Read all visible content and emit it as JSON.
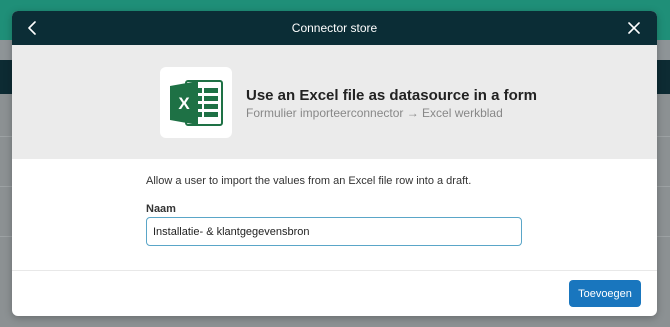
{
  "modal": {
    "title": "Connector store",
    "back_icon": "chevron-left-icon",
    "close_icon": "close-icon"
  },
  "connector": {
    "icon": "excel-icon",
    "title": "Use an Excel file as datasource in a form",
    "subtitle": "Formulier importeerconnector → Excel werkblad",
    "description": "Allow a user to import the values from an Excel file row into a draft."
  },
  "form": {
    "name_label": "Naam",
    "name_value": "Installatie- & klantgegevensbron"
  },
  "footer": {
    "add_label": "Toevoegen"
  },
  "colors": {
    "header": "#0b2d36",
    "primary": "#1976be",
    "excel_green": "#1e7145"
  }
}
